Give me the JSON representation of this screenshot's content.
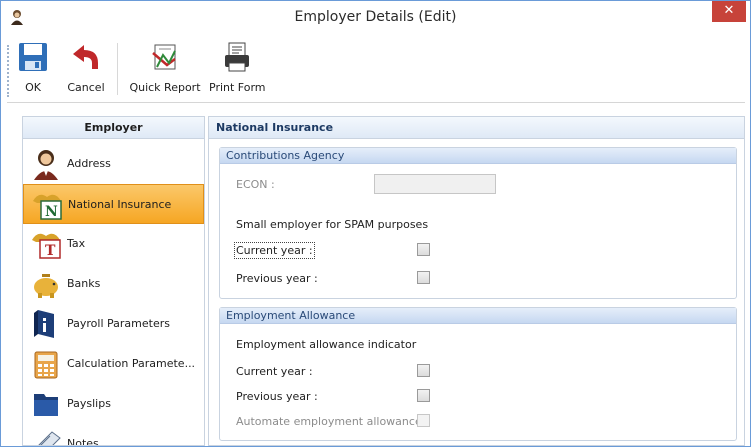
{
  "window": {
    "title": "Employer Details (Edit)",
    "close_glyph": "✕"
  },
  "toolbar": {
    "ok_label": "OK",
    "cancel_label": "Cancel",
    "quick_report_label": "Quick Report",
    "print_form_label": "Print Form"
  },
  "nav": {
    "header": "Employer",
    "items": [
      {
        "label": "Address",
        "icon": "person-address-icon",
        "active": false
      },
      {
        "label": "National Insurance",
        "icon": "national-insurance-icon",
        "active": true
      },
      {
        "label": "Tax",
        "icon": "tax-icon",
        "active": false
      },
      {
        "label": "Banks",
        "icon": "piggy-bank-icon",
        "active": false
      },
      {
        "label": "Payroll Parameters",
        "icon": "payroll-parameters-icon",
        "active": false
      },
      {
        "label": "Calculation Paramete...",
        "icon": "calculator-icon",
        "active": false
      },
      {
        "label": "Payslips",
        "icon": "folder-icon",
        "active": false
      },
      {
        "label": "Notes",
        "icon": "notes-icon",
        "active": false
      }
    ]
  },
  "panel": {
    "header": "National Insurance",
    "contributions_agency": {
      "title": "Contributions Agency",
      "econ_label": "ECON :",
      "econ_value": "",
      "spam_heading": "Small employer for SPAM purposes",
      "current_year_label": "Current year :",
      "previous_year_label": "Previous year :",
      "current_year_checked": false,
      "previous_year_checked": false
    },
    "employment_allowance": {
      "title": "Employment Allowance",
      "indicator_heading": "Employment allowance indicator",
      "current_year_label": "Current year :",
      "previous_year_label": "Previous year :",
      "automate_label": "Automate employment allowance :",
      "current_year_checked": false,
      "previous_year_checked": false,
      "automate_checked": false
    }
  },
  "colors": {
    "accent_blue": "#6a9bd8",
    "nav_active": "#f6a623",
    "close_red": "#c7433a"
  }
}
